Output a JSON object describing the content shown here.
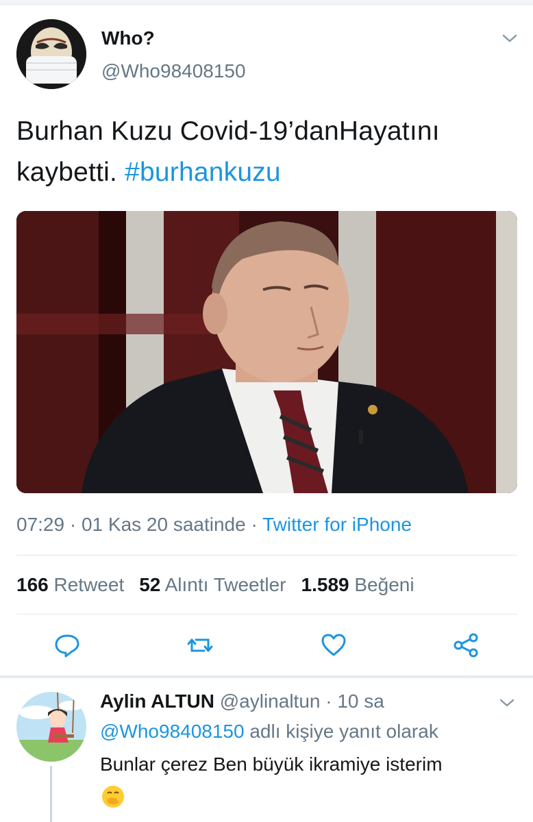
{
  "tweet": {
    "author": {
      "name": "Who?",
      "handle": "@Who98408150",
      "avatar_icon": "masked-face-avatar"
    },
    "text": "Burhan Kuzu Covid-19’danHayatını kaybetti.",
    "hashtag": "#burhankuzu",
    "image": {
      "description_icon": "man-in-suit-photo"
    },
    "meta": {
      "time": "07:29",
      "date": "01 Kas 20 saatinde",
      "separator": "·",
      "source": "Twitter for iPhone"
    },
    "stats": {
      "retweets_count": "166",
      "retweets_label": "Retweet",
      "quotes_count": "52",
      "quotes_label": "Alıntı Tweetler",
      "likes_count": "1.589",
      "likes_label": "Beğeni"
    },
    "actions": [
      {
        "icon": "reply-icon"
      },
      {
        "icon": "retweet-icon"
      },
      {
        "icon": "like-icon"
      },
      {
        "icon": "share-icon"
      }
    ]
  },
  "reply": {
    "name": "Aylin ALTUN",
    "handle": "@aylinaltun",
    "time_sep": "·",
    "time": "10 sa",
    "reply_to_handle": "@Who98408150",
    "reply_to_suffix": "adlı kişiye yanıt olarak",
    "text": "Bunlar çerez Ben büyük ikramiye isterim",
    "emoji_icon": "face-with-hand-over-mouth-icon"
  },
  "colors": {
    "accent": "#1b95e0",
    "muted": "#657786",
    "text": "#14171a",
    "divider": "#e1e8ed"
  }
}
